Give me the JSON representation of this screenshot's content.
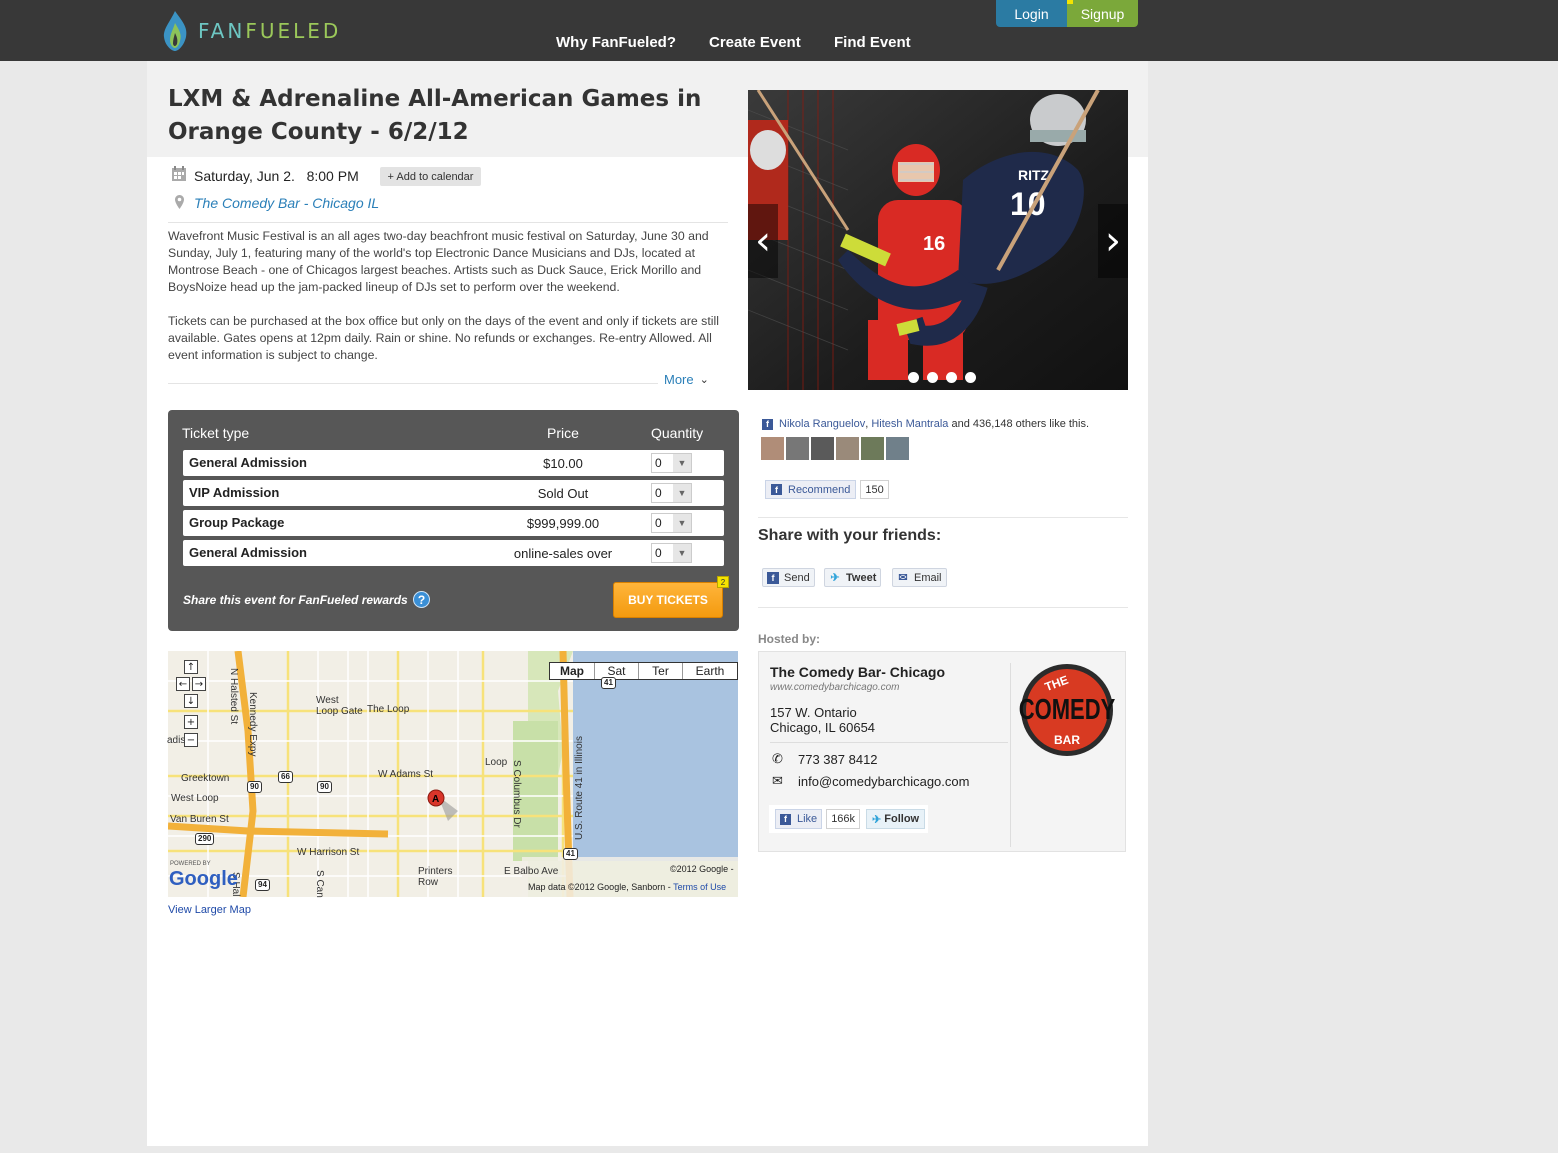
{
  "header": {
    "logo_text_a": "FAN",
    "logo_text_b": "FUELED",
    "nav": [
      "Why FanFueled?",
      "Create Event",
      "Find Event"
    ],
    "login_label": "Login",
    "signup_label": "Signup"
  },
  "event": {
    "title": "LXM & Adrenaline All-American Games in Orange County - 6/2/12",
    "date": "Saturday, Jun 2.",
    "time": "8:00 PM",
    "add_calendar_label": "+ Add to calendar",
    "venue": "The Comedy Bar - Chicago IL",
    "description": [
      "Wavefront Music Festival is an all ages two-day beachfront music festival on Saturday, June 30 and Sunday, July 1, featuring many of the world's top Electronic Dance Musicians and DJs, located at Montrose Beach - one of Chicagos largest beaches.  Artists such as Duck Sauce, Erick Morillo and BoysNoize head up the jam-packed lineup of DJs set to perform over the weekend.",
      "Tickets can be purchased at the box office but only on the days of the event and only if tickets are still available. Gates opens at 12pm daily. Rain or shine. No refunds or exchanges. Re-entry Allowed. All event information is subject to change."
    ],
    "more_label": "More"
  },
  "hero": {
    "player_jersey": "RITZ",
    "player_number": "10",
    "slide_count": 4
  },
  "tickets": {
    "headers": {
      "type": "Ticket type",
      "price": "Price",
      "quantity": "Quantity"
    },
    "rows": [
      {
        "name": "General Admission",
        "price": "$10.00",
        "qty": "0"
      },
      {
        "name": "VIP Admission",
        "price": "Sold Out",
        "qty": "0"
      },
      {
        "name": "Group Package",
        "price": "$999,999.00",
        "qty": "0"
      },
      {
        "name": "General Admission",
        "price": "online-sales over",
        "qty": "0"
      }
    ],
    "share_rewards": "Share this event for FanFueled rewards",
    "buy_label": "BUY TICKETS",
    "buy_badge": "2"
  },
  "map": {
    "types": [
      "Map",
      "Sat",
      "Ter",
      "Earth"
    ],
    "active_type": "Map",
    "labels": {
      "west_loop_gate": "West\nLoop Gate",
      "the_loop": "The Loop",
      "greektown": "Greektown",
      "west_loop": "West Loop",
      "van_buren": "Van Buren St",
      "w_adams": "W Adams St",
      "w_harrison": "W Harrison St",
      "loop": "Loop",
      "printers_row": "Printers\nRow",
      "e_balbo": "E Balbo Ave",
      "s_columbus": "S Columbus Dr",
      "route41": "U.S. Route 41 in Illinois",
      "kennedy": "Kennedy Expy",
      "halsted": "N Halsted St",
      "s_halsted": "S Hal",
      "s_can": "S Can",
      "adison": "adis",
      "marker": "A"
    },
    "shields": [
      "41",
      "90",
      "66",
      "90",
      "290",
      "94",
      "41"
    ],
    "copyright": "©2012 Google -",
    "data_credit": "Map data ©2012 Google, Sanborn -",
    "terms_label": "Terms of Use",
    "powered_by": "POWERED BY",
    "google": "Google",
    "view_larger": "View Larger Map"
  },
  "social": {
    "friend1": "Nikola Ranguelov",
    "friend2": "Hitesh Mantrala",
    "like_suffix": "and 436,148 others like this.",
    "recommend_label": "Recommend",
    "recommend_count": "150",
    "share_title": "Share with your friends:",
    "send_label": "Send",
    "tweet_label": "Tweet",
    "email_label": "Email"
  },
  "host": {
    "hosted_by": "Hosted by:",
    "name": "The Comedy Bar- Chicago",
    "url": "www.comedybarchicago.com",
    "address1": "157 W. Ontario",
    "address2": "Chicago, IL 60654",
    "phone": "773 387 8412",
    "email": "info@comedybarchicago.com",
    "like_label": "Like",
    "like_count": "166k",
    "follow_label": "Follow",
    "logo_the": "THE",
    "logo_comedy": "COMEDY",
    "logo_bar": "BAR"
  },
  "colors": {
    "topbar": "#383838",
    "login": "#2b7ba3",
    "signup": "#7ba83a",
    "link": "#2a7fb8",
    "ticket_panel": "#575757",
    "buy": "#f39a0f"
  }
}
